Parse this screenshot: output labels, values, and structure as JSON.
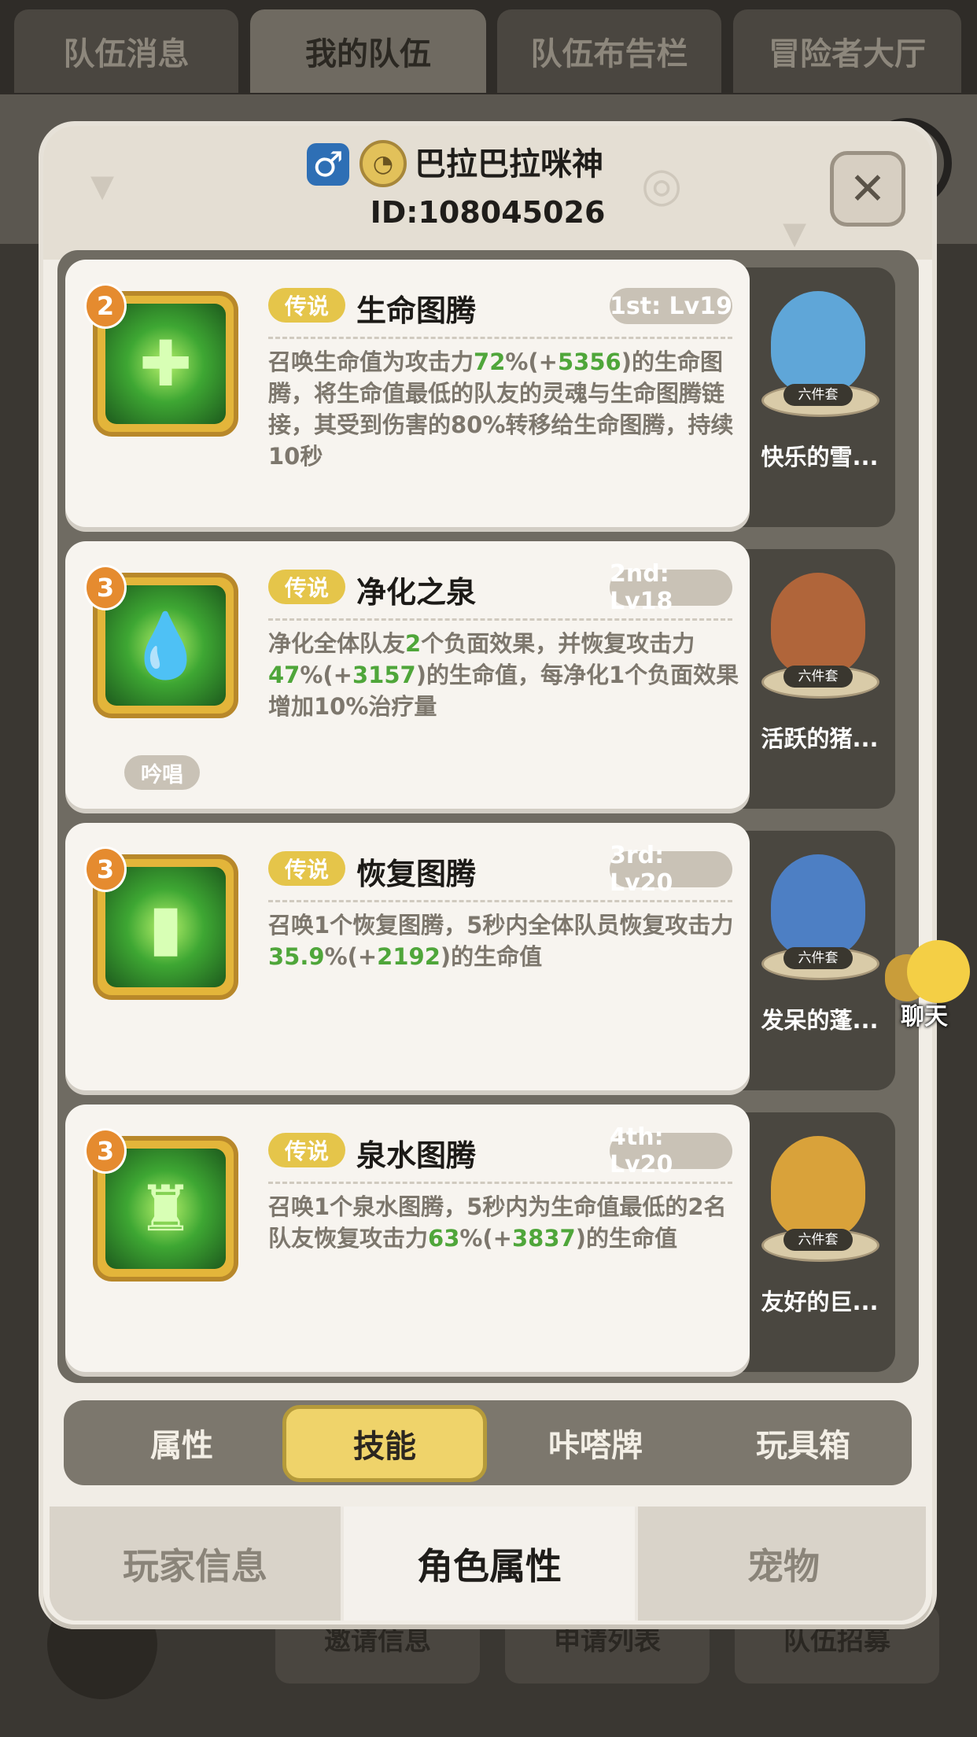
{
  "bg_tabs": [
    "队伍消息",
    "我的队伍",
    "队伍布告栏",
    "冒险者大厅"
  ],
  "bg_bottom_buttons": [
    "邀请信息",
    "申请列表",
    "队伍招募"
  ],
  "player": {
    "name": "巴拉巴拉咪神",
    "id": "ID:108045026",
    "gender_icon": "male-icon"
  },
  "close_icon": "✕",
  "skills": [
    {
      "level": "2",
      "rarity": "传说",
      "name": "生命图腾",
      "rank": "1st: Lv19",
      "desc_parts": [
        "召唤生命值为攻击力",
        "72",
        "%(+",
        "5356",
        ")的生命图腾，将生命值最低的队友的灵魂与生命图腾链接，其受到伤害的80%转移给生命图腾，持续10秒"
      ],
      "chant": "",
      "icon": "totem-plus-icon",
      "companion": {
        "set": "六件套",
        "name": "快乐的雪..."
      }
    },
    {
      "level": "3",
      "rarity": "传说",
      "name": "净化之泉",
      "rank": "2nd: Lv18",
      "desc_parts": [
        "净化全体队友",
        "2",
        "个负面效果，并恢复攻击力",
        "47",
        "%(+",
        "3157",
        ")的生命值，每净化1个负面效果增加10%治疗量"
      ],
      "chant": "吟唱",
      "icon": "droplet-icon",
      "companion": {
        "set": "六件套",
        "name": "活跃的猪..."
      }
    },
    {
      "level": "3",
      "rarity": "传说",
      "name": "恢复图腾",
      "rank": "3rd: Lv20",
      "desc_parts": [
        "召唤1个恢复图腾，5秒内全体队员恢复攻击力",
        "35.9",
        "%(+",
        "2192",
        ")的生命值"
      ],
      "chant": "",
      "icon": "totem-icon",
      "companion": {
        "set": "六件套",
        "name": "发呆的蓬..."
      }
    },
    {
      "level": "3",
      "rarity": "传说",
      "name": "泉水图腾",
      "rank": "4th: Lv20",
      "desc_parts": [
        "召唤1个泉水图腾，5秒内为生命值最低的2名队友恢复攻击力",
        "63",
        "%(+",
        "3837",
        ")的生命值"
      ],
      "chant": "",
      "icon": "fountain-totem-icon",
      "companion": {
        "set": "六件套",
        "name": "友好的巨..."
      }
    }
  ],
  "subtabs": [
    "属性",
    "技能",
    "咔嗒牌",
    "玩具箱"
  ],
  "subtab_active": 1,
  "main_tabs": [
    "玩家信息",
    "角色属性",
    "宠物"
  ],
  "main_tab_active": 1,
  "chat": {
    "label": "聊天"
  }
}
